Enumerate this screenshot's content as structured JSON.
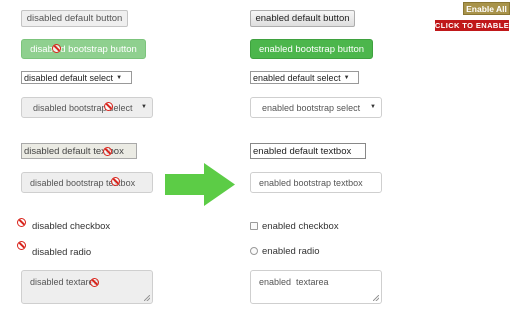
{
  "colors": {
    "bootstrap_disabled": "#8fd08f",
    "bootstrap_enabled": "#4cb64c",
    "arrow": "#5ccc46",
    "enable_all_bg": "#a8934a",
    "click_to_enable_bg": "#c0181a",
    "not_allowed_icon": "#d9241c"
  },
  "toolbar": {
    "enable_all_label": "Enable All",
    "click_to_enable_label": "CLICK TO ENABLE"
  },
  "disabled": {
    "default_button": "disabled default button",
    "bootstrap_button": "disabled bootstrap button",
    "default_select": "disabled default select",
    "bootstrap_select": "disabled bootstrap select",
    "default_textbox": "disabled default textbox",
    "bootstrap_textbox": "disabled bootstrap textbox",
    "checkbox": "disabled checkbox",
    "radio": "disabled radio",
    "textarea": "disabled textarea"
  },
  "enabled": {
    "default_button": "enabled default button",
    "bootstrap_button": "enabled bootstrap button",
    "default_select": "enabled default select",
    "bootstrap_select": "enabled bootstrap select",
    "default_textbox": "enabled default textbox",
    "bootstrap_textbox": "enabled bootstrap textbox",
    "checkbox": "enabled checkbox",
    "radio": "enabled radio",
    "textarea": "enabled  textarea"
  },
  "icons": {
    "transition_arrow": "right-arrow-icon",
    "not_allowed": "not-allowed-icon",
    "select_caret": "caret-down-icon"
  }
}
